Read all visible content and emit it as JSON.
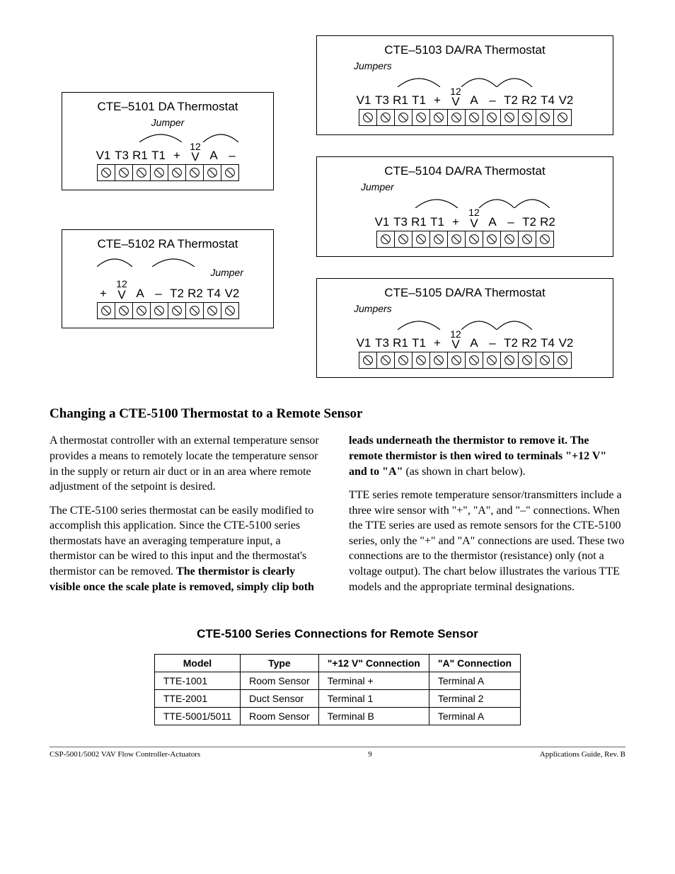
{
  "diagrams": {
    "d5101": {
      "title": "CTE–5101 DA Thermostat",
      "jumper": "Jumper",
      "terminals": [
        "V1",
        "T3",
        "R1",
        "T1",
        "+",
        "12/V",
        "A",
        "–"
      ]
    },
    "d5102": {
      "title": "CTE–5102 RA Thermostat",
      "jumper": "Jumper",
      "terminals": [
        "+",
        "12/V",
        "A",
        "–",
        "T2",
        "R2",
        "T4",
        "V2"
      ]
    },
    "d5103": {
      "title": "CTE–5103 DA/RA Thermostat",
      "jumper": "Jumpers",
      "terminals": [
        "V1",
        "T3",
        "R1",
        "T1",
        "+",
        "12/V",
        "A",
        "–",
        "T2",
        "R2",
        "T4",
        "V2"
      ]
    },
    "d5104": {
      "title": "CTE–5104 DA/RA Thermostat",
      "jumper": "Jumper",
      "terminals": [
        "V1",
        "T3",
        "R1",
        "T1",
        "+",
        "12/V",
        "A",
        "–",
        "T2",
        "R2"
      ]
    },
    "d5105": {
      "title": "CTE–5105 DA/RA Thermostat",
      "jumper": "Jumpers",
      "terminals": [
        "V1",
        "T3",
        "R1",
        "T1",
        "+",
        "12/V",
        "A",
        "–",
        "T2",
        "R2",
        "T4",
        "V2"
      ]
    }
  },
  "heading": "Changing a CTE-5100 Thermostat to a Remote Sensor",
  "paragraphs": {
    "p1": "A thermostat controller with an external temperature sensor provides a means to remotely locate the temperature sensor in the supply or return air duct or in an area where remote adjustment of the setpoint is desired.",
    "p2a": "The CTE-5100 series thermostat can be easily modified to accomplish this application. Since the CTE-5100 series thermostats have an averaging temperature input, a thermistor can be wired to this input and the thermostat's thermistor can be removed. ",
    "p2b": "The thermistor is clearly visible once the scale plate is removed, simply clip both leads underneath the thermistor to remove it. The remote thermistor is then wired to terminals \"+12 V\" and to \"A\"",
    "p2c": " (as shown in chart below).",
    "p3": "TTE series remote temperature sensor/transmitters include a three wire sensor with \"+\", \"A\", and \"–\" connections. When the TTE series are used as remote sensors for the CTE-5100 series, only the \"+\" and \"A\" connections are used. These two connections are to the thermistor (resistance) only (not a voltage output). The chart below illustrates the various TTE models and the appropriate terminal designations."
  },
  "table": {
    "title": "CTE-5100 Series Connections for Remote Sensor",
    "headers": [
      "Model",
      "Type",
      "\"+12 V\" Connection",
      "\"A\" Connection"
    ],
    "rows": [
      [
        "TTE-1001",
        "Room Sensor",
        "Terminal +",
        "Terminal A"
      ],
      [
        "TTE-2001",
        "Duct Sensor",
        "Terminal 1",
        "Terminal 2"
      ],
      [
        "TTE-5001/5011",
        "Room Sensor",
        "Terminal B",
        "Terminal A"
      ]
    ]
  },
  "footer": {
    "left": "CSP-5001/5002 VAV Flow Controller-Actuators",
    "center": "9",
    "right": "Applications Guide, Rev. B"
  }
}
